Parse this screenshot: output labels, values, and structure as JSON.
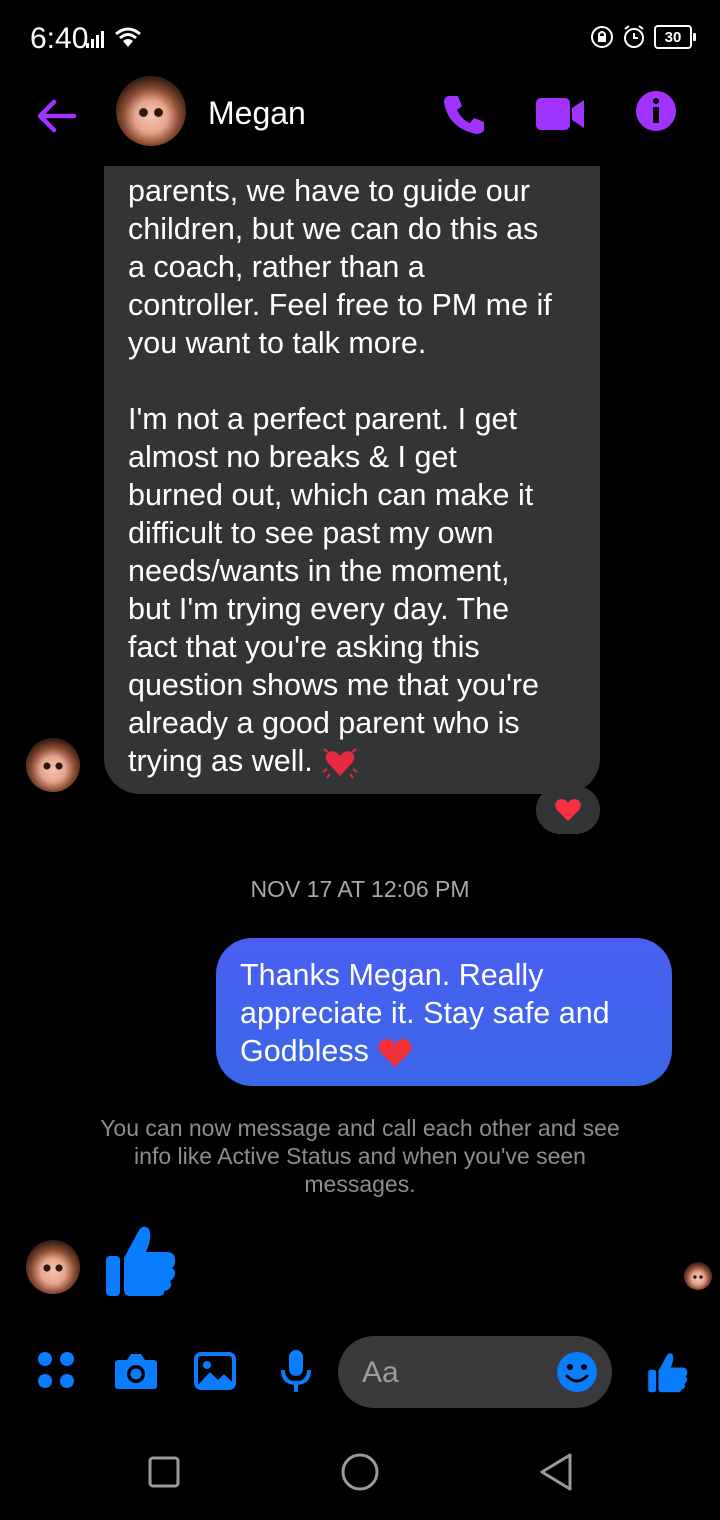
{
  "status_bar": {
    "time": "6:40",
    "battery": "30"
  },
  "header": {
    "contact_name": "Megan",
    "avatar": "megan-avatar"
  },
  "messages": {
    "incoming_text": "parents, we have to guide our\nchildren, but we can do this as\na coach, rather than a\ncontroller. Feel free to PM me if\nyou want to talk more.\n\nI'm not a perfect parent. I get\nalmost no breaks & I get\nburned out, which can make it\ndifficult to see past my own\nneeds/wants in the moment,\nbut I'm trying every day. The\nfact that you're asking this\nquestion shows me that you're\nalready a good parent who is\ntrying as well.",
    "incoming_emoji": "beating-heart",
    "reaction": "❤️",
    "timestamp": "NOV 17 AT 12:06 PM",
    "outgoing_text": "Thanks Megan. Really appreciate it. Stay safe and Godbless",
    "outgoing_emoji": "❤️",
    "notice": "You can now message and call each other and see info like Active Status and when you've seen messages."
  },
  "composer": {
    "placeholder": "Aa"
  },
  "colors": {
    "accent_purple": "#a033ff",
    "accent_blue": "#0a7cff",
    "outgoing_bubble": "#4161ee",
    "incoming_bubble": "#333436"
  }
}
